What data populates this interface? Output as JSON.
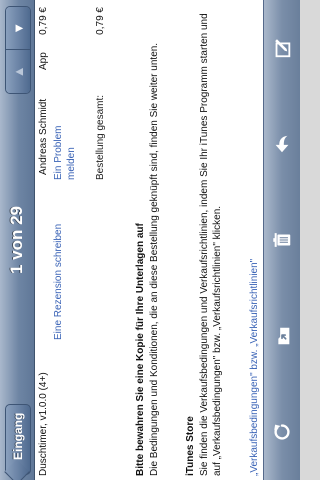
{
  "nav": {
    "back_label": "Eingang",
    "title": "1 von 29",
    "prev_arrow": "▲",
    "next_arrow": "▼"
  },
  "purchase": {
    "item_name": "Duschtimer, v1.0.0 (4+)",
    "artist": "Andreas Schmidt",
    "type": "App",
    "price": "0,79 €",
    "review_link": "Eine Rezension schreiben",
    "report_link": "Ein Problem melden",
    "total_label": "Bestellung gesamt:",
    "total_price": "0,79 €"
  },
  "notice": {
    "title": "Bitte bewahren Sie eine Kopie für Ihre Unterlagen auf",
    "body": "Die Bedingungen und Konditionen, die an diese Bestellung geknüpft sind, finden Sie weiter unten."
  },
  "store": {
    "title": "iTunes Store",
    "body": "Sie finden die Verkaufsbedingungen und Verkaufsrichtlinien, indem Sie Ihr iTunes Programm starten und auf „Verkaufsbedingungen\" bzw. „Verkaufsrichtlinien\" klicken.",
    "links": "„Verkaufsbedingungen\" bzw. „Verkaufsrichtlinien\""
  },
  "toolbar": {
    "icons": [
      "refresh-icon",
      "move-to-folder-icon",
      "trash-icon",
      "reply-icon",
      "compose-icon"
    ]
  },
  "colors": {
    "bar": "#6e85a4",
    "link": "#3a63b6"
  }
}
